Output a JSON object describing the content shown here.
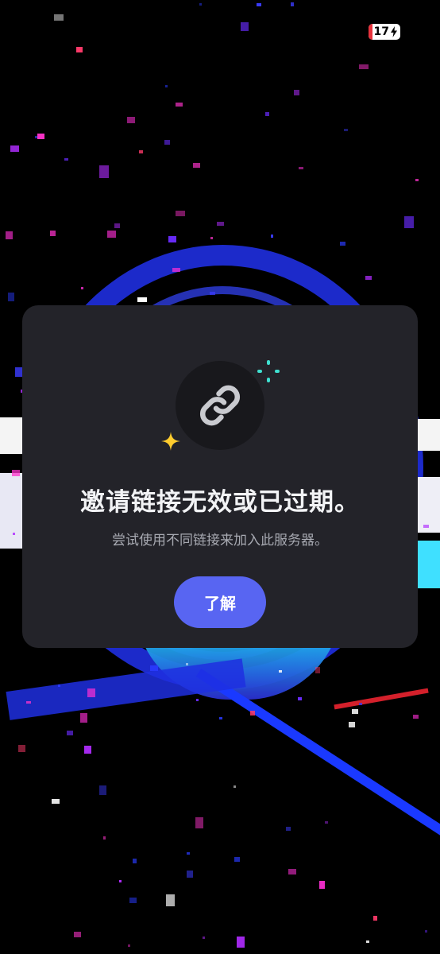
{
  "status_bar": {
    "battery_level": "17",
    "battery_icon": "battery-charging-icon",
    "charging_icon": "bolt-icon",
    "battery_low_color": "#e8323c"
  },
  "dialog": {
    "icon": "link-icon",
    "decorations": [
      "sparkle-teal-icon",
      "sparkle-yellow-icon"
    ],
    "title": "邀请链接无效或已过期。",
    "subtitle": "尝试使用不同链接来加入此服务器。",
    "ok_button_label": "了解",
    "accent_color": "#5865f2",
    "background_color": "#232329"
  }
}
